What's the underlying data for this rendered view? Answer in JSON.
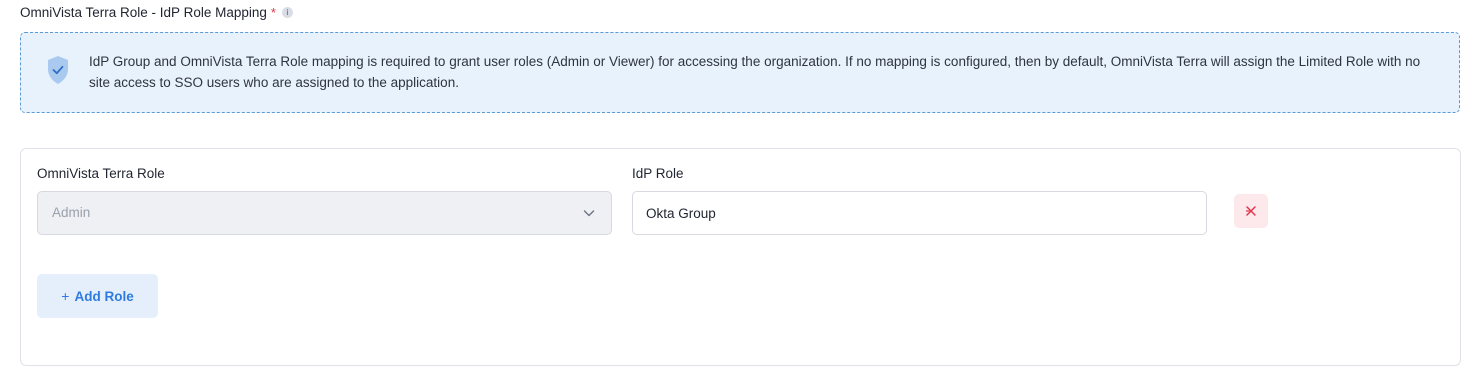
{
  "section": {
    "title": "OmniVista Terra Role - IdP Role Mapping",
    "required_marker": "*",
    "info_icon_glyph": "i"
  },
  "notice": {
    "icon": "shield-check-icon",
    "text": "IdP Group and OmniVista Terra Role mapping is required to grant user roles (Admin or Viewer) for accessing the organization. If no mapping is configured, then by default, OmniVista Terra will assign the Limited Role with no site access to SSO users who are assigned to the application."
  },
  "mapping": {
    "role_label": "OmniVista Terra Role",
    "role_value": "Admin",
    "idp_label": "IdP Role",
    "idp_value": "Okta Group",
    "remove_icon": "remove-x-icon"
  },
  "actions": {
    "add_role_icon": "+",
    "add_role_label": "Add Role"
  },
  "colors": {
    "accent": "#2d7be0",
    "notice_bg": "#e8f2fd",
    "notice_border": "#5b9bd5",
    "danger": "#e0354a",
    "danger_bg": "#fde8ec"
  }
}
